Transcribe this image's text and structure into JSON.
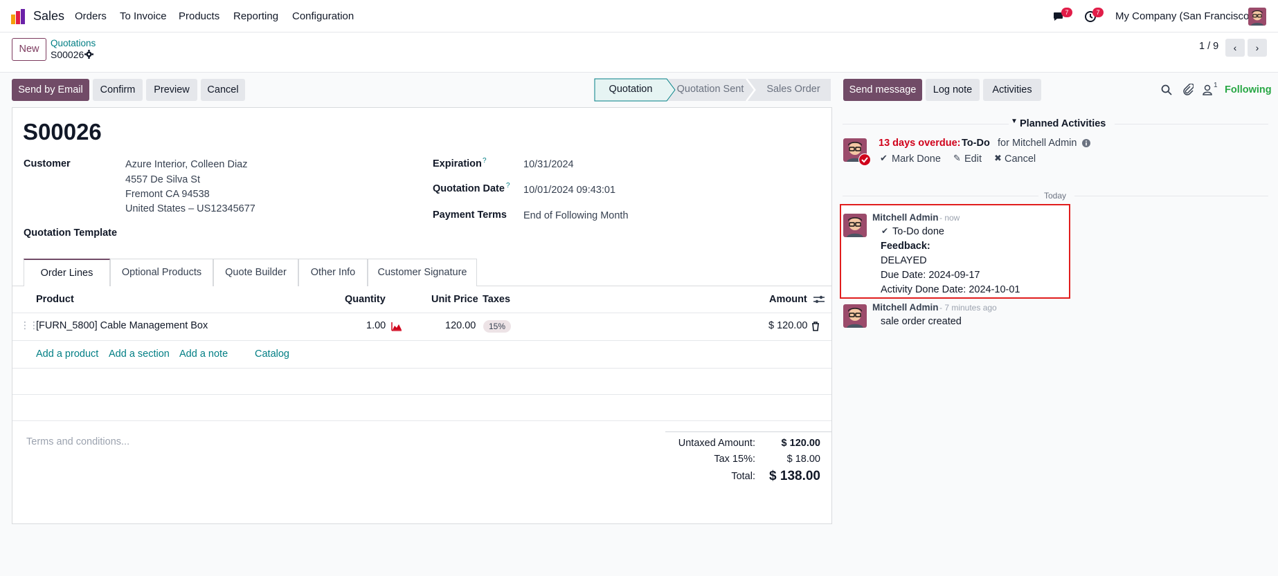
{
  "nav": {
    "app_name": "Sales",
    "menu": [
      "Orders",
      "To Invoice",
      "Products",
      "Reporting",
      "Configuration"
    ],
    "messages_count": "7",
    "activities_count": "7",
    "company": "My Company (San Francisco)"
  },
  "control": {
    "new_label": "New",
    "breadcrumb_parent": "Quotations",
    "breadcrumb_current": "S00026",
    "pager": "1 / 9"
  },
  "actions": {
    "send_email": "Send by Email",
    "confirm": "Confirm",
    "preview": "Preview",
    "cancel": "Cancel"
  },
  "statusbar": [
    "Quotation",
    "Quotation Sent",
    "Sales Order"
  ],
  "chatter_actions": {
    "send_message": "Send message",
    "log_note": "Log note",
    "activities": "Activities",
    "followers_count": "1",
    "following": "Following"
  },
  "form": {
    "name": "S00026",
    "customer_label": "Customer",
    "customer_lines": [
      "Azure Interior, Colleen Diaz",
      "4557 De Silva St",
      "Fremont CA 94538",
      "United States – US12345677"
    ],
    "template_label": "Quotation Template",
    "expiration_label": "Expiration",
    "expiration_value": "10/31/2024",
    "quotation_date_label": "Quotation Date",
    "quotation_date_value": "10/01/2024 09:43:01",
    "payment_terms_label": "Payment Terms",
    "payment_terms_value": "End of Following Month",
    "help_mark": "?"
  },
  "tabs": [
    "Order Lines",
    "Optional Products",
    "Quote Builder",
    "Other Info",
    "Customer Signature"
  ],
  "lines": {
    "headers": {
      "product": "Product",
      "quantity": "Quantity",
      "unit_price": "Unit Price",
      "taxes": "Taxes",
      "amount": "Amount"
    },
    "rows": [
      {
        "product": "[FURN_5800] Cable Management Box",
        "quantity": "1.00",
        "unit_price": "120.00",
        "tax": "15%",
        "amount": "$ 120.00"
      }
    ],
    "add_product": "Add a product",
    "add_section": "Add a section",
    "add_note": "Add a note",
    "catalog": "Catalog"
  },
  "totals": {
    "terms_placeholder": "Terms and conditions...",
    "untaxed_label": "Untaxed Amount:",
    "untaxed_value": "$ 120.00",
    "tax_label": "Tax 15%:",
    "tax_value": "$ 18.00",
    "total_label": "Total:",
    "total_value": "$ 138.00"
  },
  "planned": {
    "heading": "Planned Activities",
    "overdue": "13 days overdue:",
    "type": "To-Do",
    "for": "for Mitchell Admin",
    "mark_done": "Mark Done",
    "edit": "Edit",
    "cancel": "Cancel"
  },
  "feed": {
    "today": "Today",
    "messages": [
      {
        "author": "Mitchell Admin",
        "time": "- now",
        "todo_done": "To-Do done",
        "feedback_label": "Feedback:",
        "feedback": "DELAYED",
        "due": "Due Date: 2024-09-17",
        "done": "Activity Done Date: 2024-10-01"
      },
      {
        "author": "Mitchell Admin",
        "time": "- 7 minutes ago",
        "body": "sale order created"
      }
    ]
  },
  "colors": {
    "brand": "#714b67",
    "teal": "#017e84",
    "danger": "#d0021b",
    "highlight": "#e11d1d",
    "following": "#28a745"
  }
}
